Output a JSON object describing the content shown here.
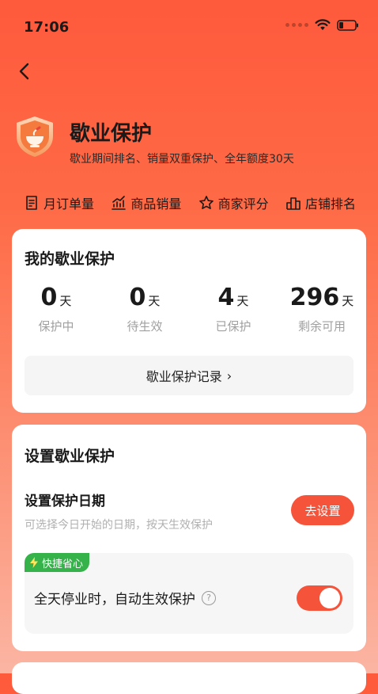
{
  "status_bar": {
    "time": "17:06"
  },
  "hero": {
    "title": "歇业保护",
    "subtitle": "歇业期间排名、销量双重保护、全年额度30天"
  },
  "benefits": [
    {
      "label": "月订单量",
      "icon": "document-icon"
    },
    {
      "label": "商品销量",
      "icon": "trend-chart-icon"
    },
    {
      "label": "商家评分",
      "icon": "star-icon"
    },
    {
      "label": "店铺排名",
      "icon": "bar-ranking-icon"
    }
  ],
  "my_protection": {
    "title": "我的歇业保护",
    "stats": [
      {
        "value": "0",
        "unit": "天",
        "label": "保护中"
      },
      {
        "value": "0",
        "unit": "天",
        "label": "待生效"
      },
      {
        "value": "4",
        "unit": "天",
        "label": "已保护"
      },
      {
        "value": "296",
        "unit": "天",
        "label": "剩余可用"
      }
    ],
    "record_button": "歇业保护记录",
    "record_chevron": "›"
  },
  "settings": {
    "title": "设置歇业保护",
    "date_title": "设置保护日期",
    "date_desc": "可选择今日开始的日期，按天生效保护",
    "set_button": "去设置",
    "quick_tag": "快捷省心",
    "auto_text": "全天停业时，自动生效保护",
    "help_symbol": "?",
    "auto_enabled": true
  },
  "colors": {
    "accent": "#f5533a",
    "quick_tag": "#36b24a"
  }
}
